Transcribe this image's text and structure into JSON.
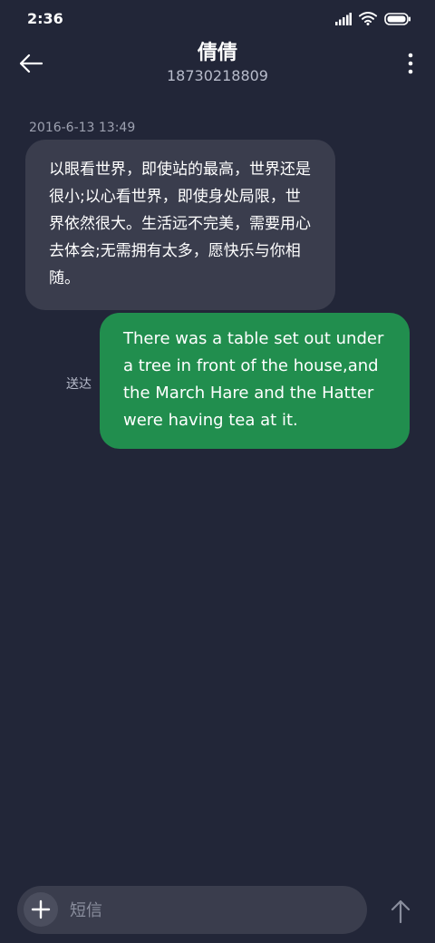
{
  "status_bar": {
    "time": "2:36",
    "icons": [
      "signal-icon",
      "wifi-icon",
      "battery-icon"
    ]
  },
  "header": {
    "contact_name": "倩倩",
    "contact_number": "18730218809",
    "back_icon": "back-arrow-icon",
    "more_icon": "more-vertical-icon"
  },
  "conversation": {
    "timestamp": "2016-6-13 13:49",
    "incoming": {
      "text": "以眼看世界，即使站的最高，世界还是很小;以心看世界，即使身处局限，世界依然很大。生活远不完美，需要用心去体会;无需拥有太多，愿快乐与你相随。"
    },
    "outgoing": {
      "text": "There was a table set out under a tree in front of the house,and the March Hare and the Hatter were having tea at it.",
      "status": "送达"
    }
  },
  "composer": {
    "placeholder": "短信",
    "value": "",
    "add_icon": "plus-icon",
    "send_icon": "send-arrow-icon"
  },
  "colors": {
    "background": "#222638",
    "incoming_bubble": "#3a3d4d",
    "outgoing_bubble": "#218e4e",
    "muted_text": "#9da1b0"
  }
}
